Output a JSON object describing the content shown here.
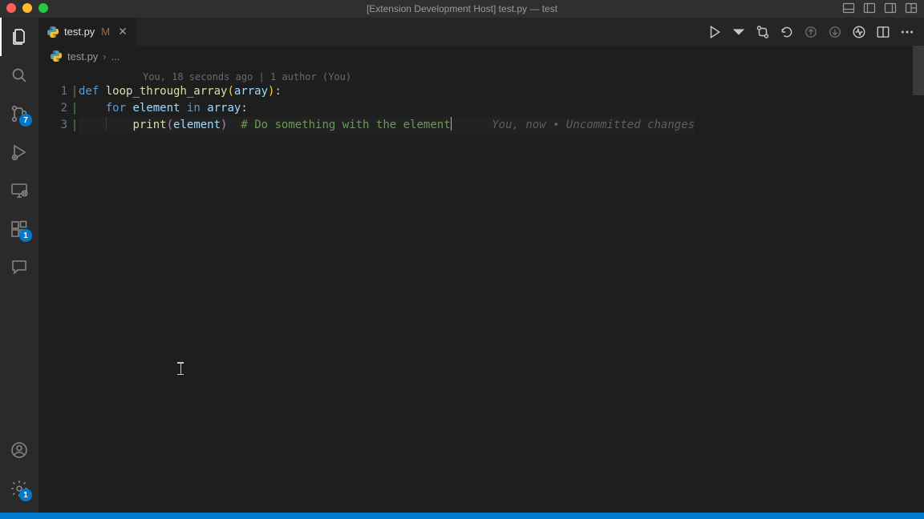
{
  "titlebar": {
    "text": "[Extension Development Host] test.py — test"
  },
  "activitybar": {
    "source_badge": "7",
    "extensions_badge": "1",
    "settings_badge": "1"
  },
  "tab": {
    "filename": "test.py",
    "modified": "M"
  },
  "breadcrumb": {
    "file": "test.py",
    "trail": "..."
  },
  "codelens": "You, 18 seconds ago | 1 author (You)",
  "lines": {
    "l1": {
      "num": "1"
    },
    "l2": {
      "num": "2"
    },
    "l3": {
      "num": "3"
    }
  },
  "tokens": {
    "def": "def",
    "fn_name": "loop_through_array",
    "lp": "(",
    "param": "array",
    "rp": ")",
    "colon": ":",
    "for": "for",
    "elvar": "element",
    "in": "in",
    "arr": "array",
    "print": "print",
    "comment": "# Do something with the element"
  },
  "blame": "You, now • Uncommitted changes"
}
